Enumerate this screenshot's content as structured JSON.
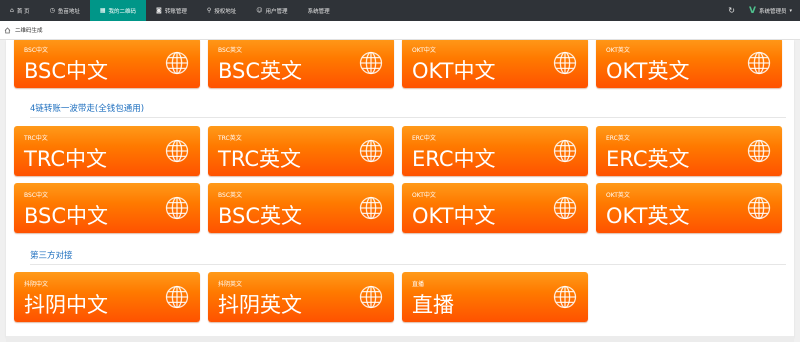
{
  "nav": {
    "items": [
      {
        "label": "首 页",
        "icon": "home-icon"
      },
      {
        "label": "鱼苗地址",
        "icon": "clock-icon"
      },
      {
        "label": "我的二维码",
        "icon": "qrcode-icon"
      },
      {
        "label": "转账管理",
        "icon": "transfer-icon"
      },
      {
        "label": "授权地址",
        "icon": "location-icon"
      },
      {
        "label": "用户管理",
        "icon": "user-icon"
      },
      {
        "label": "系统管理",
        "icon": ""
      }
    ],
    "active_index": 2,
    "admin_label": "系统管理员",
    "refresh_icon": "refresh-icon"
  },
  "breadcrumb": {
    "current": "二维码生成"
  },
  "sections": {
    "top_row": [
      {
        "small": "BSC中文",
        "big": "BSC中文"
      },
      {
        "small": "BSC英文",
        "big": "BSC英文"
      },
      {
        "small": "OKT中文",
        "big": "OKT中文"
      },
      {
        "small": "OKT英文",
        "big": "OKT英文"
      }
    ],
    "chain4_title": "4链转账一波带走(全钱包通用)",
    "chain4_row1": [
      {
        "small": "TRC中文",
        "big": "TRC中文"
      },
      {
        "small": "TRC英文",
        "big": "TRC英文"
      },
      {
        "small": "ERC中文",
        "big": "ERC中文"
      },
      {
        "small": "ERC英文",
        "big": "ERC英文"
      }
    ],
    "chain4_row2": [
      {
        "small": "BSC中文",
        "big": "BSC中文"
      },
      {
        "small": "BSC英文",
        "big": "BSC英文"
      },
      {
        "small": "OKT中文",
        "big": "OKT中文"
      },
      {
        "small": "OKT英文",
        "big": "OKT英文"
      }
    ],
    "third_title": "第三方对接",
    "third_row": [
      {
        "small": "抖阴中文",
        "big": "抖阴中文"
      },
      {
        "small": "抖阴英文",
        "big": "抖阴英文"
      },
      {
        "small": "直播",
        "big": "直播"
      }
    ]
  },
  "colors": {
    "nav_bg": "#2f3338",
    "nav_active": "#009688",
    "button_orange": "#ff6a00",
    "section_title": "#1e6fbf"
  }
}
